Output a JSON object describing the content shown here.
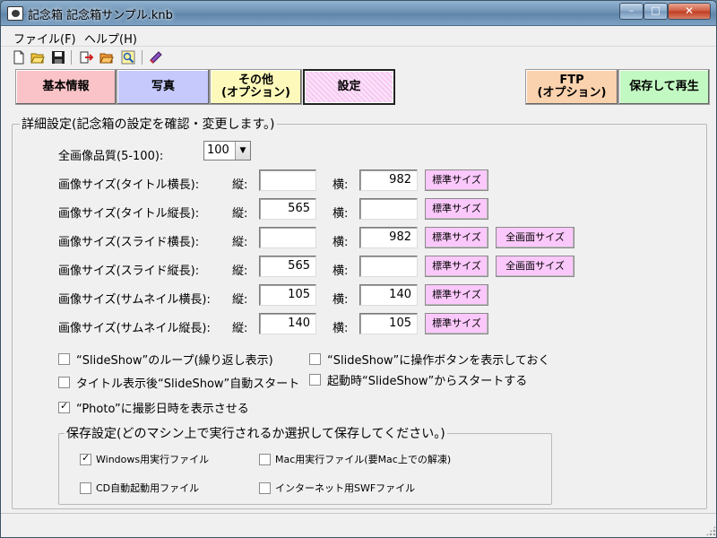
{
  "window": {
    "title": "記念箱 記念箱サンプル.knb",
    "minimize_glyph": "–",
    "maximize_glyph": "□",
    "close_glyph": "✕"
  },
  "menu": {
    "file": "ファイル(F)",
    "help": "ヘルプ(H)"
  },
  "toolbar": {
    "icons": [
      "new-document-icon",
      "open-folder-icon",
      "save-floppy-icon",
      "export-icon",
      "open-project-icon",
      "search-image-icon",
      "book-icon"
    ]
  },
  "tabs": {
    "basic": "基本情報",
    "photo": "写真",
    "other": "その他\n(オプション)",
    "settings": "設定",
    "ftp": "FTP\n(オプション)",
    "save_play": "保存して再生",
    "colors": {
      "basic": "#f9c3c8",
      "photo": "#c5c9fb",
      "other": "#fcf9ba",
      "settings": "#f7c8f3",
      "ftp": "#fbd2ae",
      "save_play": "#c2f8c2"
    }
  },
  "details": {
    "legend": "詳細設定(記念箱の設定を確認・変更します。)",
    "quality_label": "全画像品質(5-100):",
    "quality_value": "100",
    "vertical_label": "縦:",
    "horizontal_label": "横:",
    "standard_size": "標準サイズ",
    "fullscreen_size": "全画面サイズ",
    "rows": [
      {
        "label": "画像サイズ(タイトル横長):",
        "vertical": "",
        "horizontal": "982"
      },
      {
        "label": "画像サイズ(タイトル縦長):",
        "vertical": "565",
        "horizontal": ""
      },
      {
        "label": "画像サイズ(スライド横長):",
        "vertical": "",
        "horizontal": "982"
      },
      {
        "label": "画像サイズ(スライド縦長):",
        "vertical": "565",
        "horizontal": ""
      },
      {
        "label": "画像サイズ(サムネイル横長):",
        "vertical": "105",
        "horizontal": "140"
      },
      {
        "label": "画像サイズ(サムネイル縦長):",
        "vertical": "140",
        "horizontal": "105"
      }
    ],
    "options": {
      "loop": "“SlideShow”のループ(繰り返し表示)",
      "show_buttons": "“SlideShow”に操作ボタンを表示しておく",
      "autostart": "タイトル表示後“SlideShow”自動スタート",
      "start_from_slideshow": "起動時“SlideShow”からスタートする",
      "show_date": "“Photo”に撮影日時を表示させる"
    },
    "checks": {
      "loop": false,
      "show_buttons": false,
      "autostart": false,
      "start_from_slideshow": false,
      "show_date": true
    }
  },
  "save_settings": {
    "legend": "保存設定(どのマシン上で実行されるか選択して保存してください。)",
    "windows": "Windows用実行ファイル",
    "mac": "Mac用実行ファイル(要Mac上での解凍)",
    "cd": "CD自動起動用ファイル",
    "swf": "インターネット用SWFファイル",
    "checks": {
      "windows": true,
      "mac": false,
      "cd": false,
      "swf": false
    }
  },
  "checkmark_glyph": "✓"
}
